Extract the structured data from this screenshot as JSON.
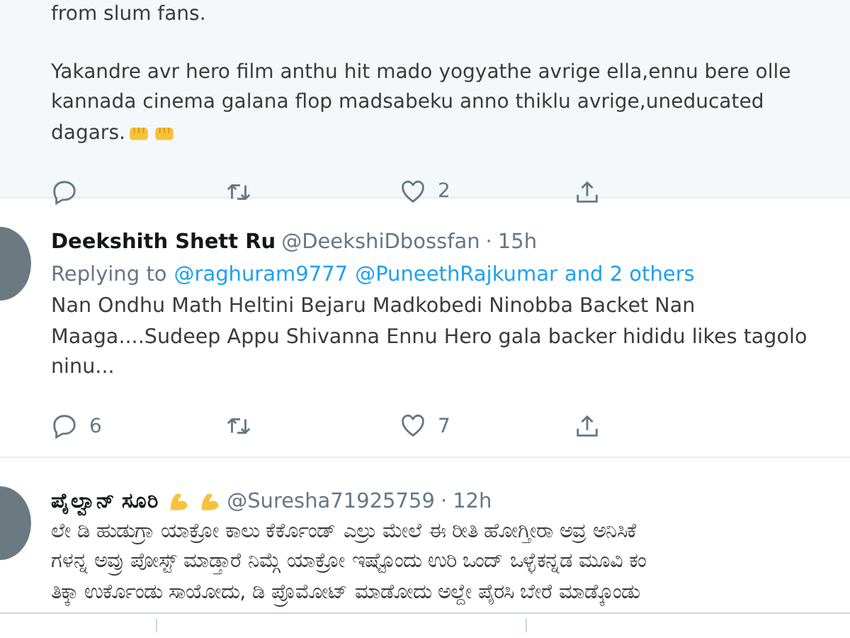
{
  "tweets": [
    {
      "kind": "continuation",
      "paragraphs": [
        [
          "from slum fans."
        ],
        [
          "Yakandre avr hero film anthu hit mado yogyathe avrige ella,ennu bere olle",
          "kannada cinema galana flop madsabeku anno thiklu avrige,uneducated",
          "dagars."
        ]
      ],
      "end_badges": [
        {
          "kind": "fist"
        },
        {
          "kind": "fist"
        }
      ],
      "actions": [
        {
          "kind": "reply"
        },
        {
          "kind": "retweet"
        },
        {
          "kind": "like",
          "count": "2"
        },
        {
          "kind": "share"
        }
      ]
    },
    {
      "kind": "reply",
      "name": "Deekshith Shett Ru",
      "handle": "@DeekshiDbossfan",
      "separator": "·",
      "time": "15h",
      "replying_label": "Replying to",
      "replying_to": [
        "@raghuram9777",
        "@PuneethRajkumar",
        "and 2 others"
      ],
      "paragraphs": [
        [
          "Nan Ondhu Math Heltini Bejaru Madkobedi Ninobba Backet Nan",
          "Maaga....Sudeep Appu Shivanna Ennu Hero gala backer hididu likes tagolo",
          "ninu..."
        ]
      ],
      "actions": [
        {
          "kind": "reply",
          "count": "6"
        },
        {
          "kind": "retweet"
        },
        {
          "kind": "like",
          "count": "7"
        },
        {
          "kind": "share"
        }
      ]
    },
    {
      "kind": "reply",
      "name": "ಪೈಲ್ವಾನ್ ಸೂರಿ",
      "name_badges": [
        {
          "kind": "flexed-arm"
        },
        {
          "kind": "flexed-arm"
        }
      ],
      "handle": "@Suresha71925759",
      "separator": "·",
      "time": "12h",
      "paragraphs": [
        [
          "ಲೇ ಡಿ ಹುಡುಗ್ರಾ ಯಾಕ್ರೋ ಕಾಲು ಕೆರ್ಕೊಂಡ್ ಎಲ್ರು ಮೇಲೆ ಈ ರೀತಿ ಹೋಗ್ತೀರಾ ಅವ್ರ ಅನಿಸಿಕೆ",
          "ಗಳನ್ನ ಅವ್ರು ಪೋಸ್ಟ್ ಮಾಡ್ತಾರೆ ನಿಮ್ಗೆ ಯಾಕ್ರೋ ಇಷ್ಟೊಂದು ಉರಿ ಒಂದ್ ಒಳ್ಳೆಕನ್ನಡ  ಮೂವಿ ಕಂ",
          "ತಿಕ್ಕಾ ಉರ್ಕೊಂಡು ಸಾಯೋದು, ಡಿ ಪ್ರೊಮೋಟ್ ಮಾಡೋದು ಅಲ್ದೇ ಪೈರಸಿ ಬೇರೆ ಮಾಡ್ಕೊಂಡು"
        ]
      ]
    }
  ]
}
